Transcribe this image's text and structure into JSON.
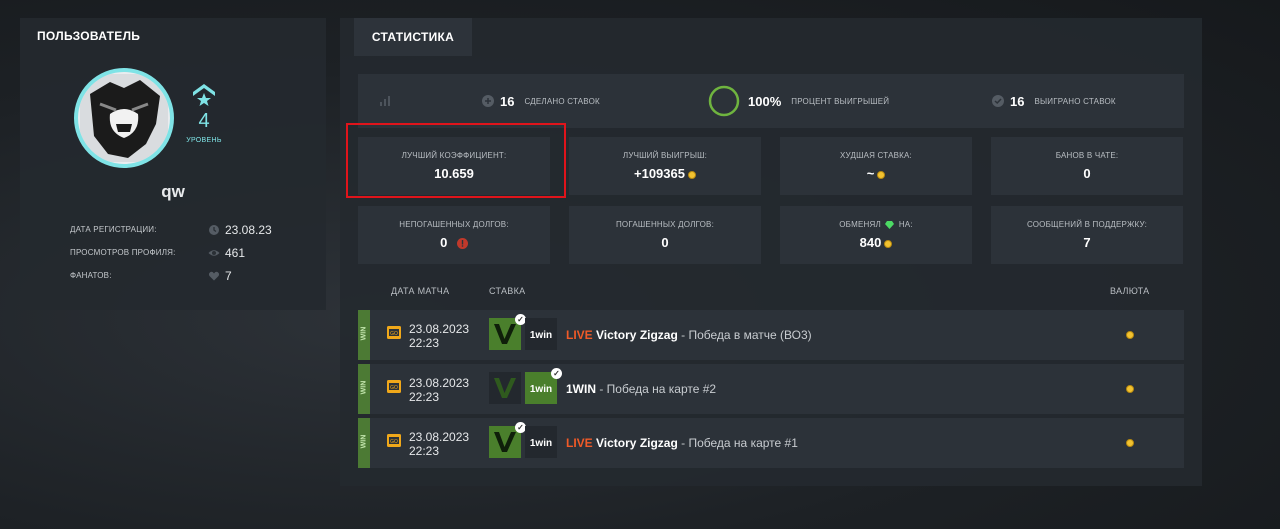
{
  "user": {
    "panel_title": "ПОЛЬЗОВАТЕЛЬ",
    "level_number": "4",
    "level_label": "УРОВЕНЬ",
    "username": "qw",
    "info": [
      {
        "label": "ДАТА РЕГИСТРАЦИИ:",
        "value": "23.08.23",
        "icon": "clock-icon"
      },
      {
        "label": "ПРОСМОТРОВ ПРОФИЛЯ:",
        "value": "461",
        "icon": "eye-icon"
      },
      {
        "label": "ФАНАТОВ:",
        "value": "7",
        "icon": "heart-icon"
      }
    ]
  },
  "stats": {
    "tab_label": "СТАТИСТИКА",
    "summary": {
      "made_count": "16",
      "made_label": "СДЕЛАНО СТАВОК",
      "win_percent": "100%",
      "win_percent_label": "ПРОЦЕНТ ВЫИГРЫШЕЙ",
      "won_count": "16",
      "won_label": "ВЫИГРАНО СТАВОК"
    },
    "cards": [
      {
        "label": "ЛУЧШИЙ КОЭФФИЦИЕНТ:",
        "value": "10.659"
      },
      {
        "label": "ЛУЧШИЙ ВЫИГРЫШ:",
        "value": "+109365"
      },
      {
        "label": "ХУДШАЯ СТАВКА:",
        "value": "~"
      },
      {
        "label": "БАНОВ В ЧАТЕ:",
        "value": "0"
      },
      {
        "label": "НЕПОГАШЕННЫХ ДОЛГОВ:",
        "value": "0"
      },
      {
        "label": "ПОГАШЕННЫХ ДОЛГОВ:",
        "value": "0"
      },
      {
        "label": "ОБМЕНЯЛ",
        "label_suffix": "НА:",
        "value": "840"
      },
      {
        "label": "СООБЩЕНИЙ В ПОДДЕРЖКУ:",
        "value": "7"
      }
    ],
    "table": {
      "headers": {
        "date": "ДАТА МАТЧА",
        "bet": "СТАВКА",
        "currency": "ВАЛЮТА"
      },
      "rows": [
        {
          "status": "WIN",
          "date": "23.08.2023",
          "time": "22:23",
          "live": "LIVE",
          "team": "Victory Zigzag",
          "desc": " - Победа в матче (ВО3)"
        },
        {
          "status": "WIN",
          "date": "23.08.2023",
          "time": "22:23",
          "live": "",
          "team": "1WIN",
          "desc": " - Победа на карте #2"
        },
        {
          "status": "WIN",
          "date": "23.08.2023",
          "time": "22:23",
          "live": "LIVE",
          "team": "Victory Zigzag",
          "desc": " - Победа на карте #1"
        }
      ]
    }
  },
  "colors": {
    "accent": "#7fe3e6",
    "win": "#4c7a34",
    "live": "#f05a28",
    "coin": "#f2c230",
    "highlight": "#e0141b"
  }
}
